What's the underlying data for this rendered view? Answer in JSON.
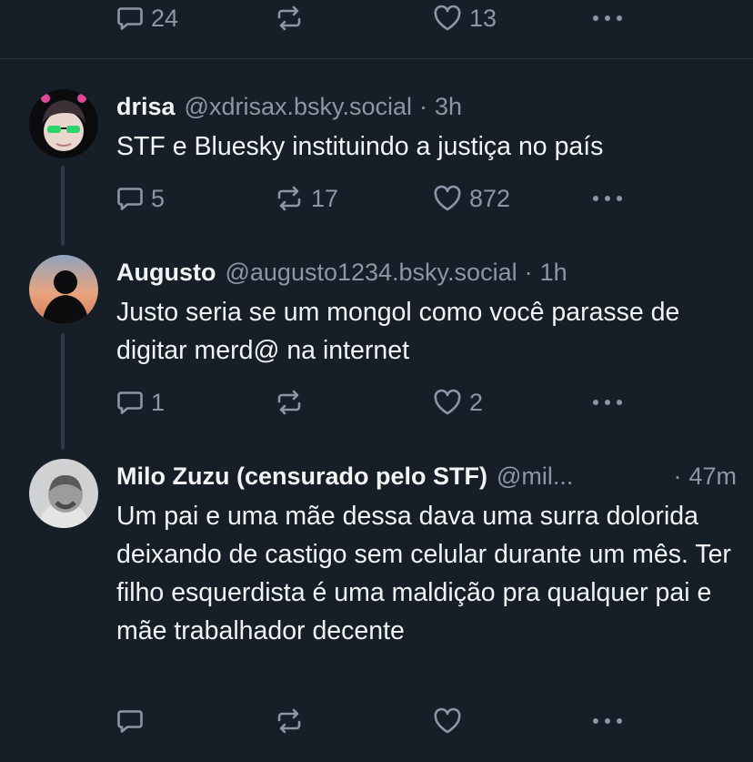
{
  "top_actions": {
    "reply_count": "24",
    "repost_count": "",
    "like_count": "13"
  },
  "posts": [
    {
      "author": "drisa",
      "handle": "@xdrisax.bsky.social",
      "separator": "·",
      "time": "3h",
      "text": "STF e Bluesky instituindo a justiça no país",
      "reply_count": "5",
      "repost_count": "17",
      "like_count": "872"
    },
    {
      "author": "Augusto",
      "handle": "@augusto1234.bsky.social",
      "separator": "·",
      "time": "1h",
      "text": "Justo seria se um mongol como você parasse de digitar merd@ na internet",
      "reply_count": "1",
      "repost_count": "",
      "like_count": "2"
    },
    {
      "author": "Milo Zuzu (censurado pelo STF)",
      "handle": "@mil...",
      "separator": "·",
      "time": "47m",
      "text": "Um pai e uma mãe dessa dava uma surra dolorida deixando de castigo sem celular durante um mês. Ter filho esquerdista é uma maldição pra qualquer pai e mãe trabalhador decente",
      "reply_count": "",
      "repost_count": "",
      "like_count": ""
    }
  ],
  "icons": {
    "reply": "reply-icon",
    "repost": "repost-icon",
    "like": "heart-icon",
    "more": "more-icon"
  },
  "colors": {
    "background": "#161e27",
    "text": "#f1f3f5",
    "muted": "#8a97a6",
    "thread_line": "#2e3a47"
  }
}
